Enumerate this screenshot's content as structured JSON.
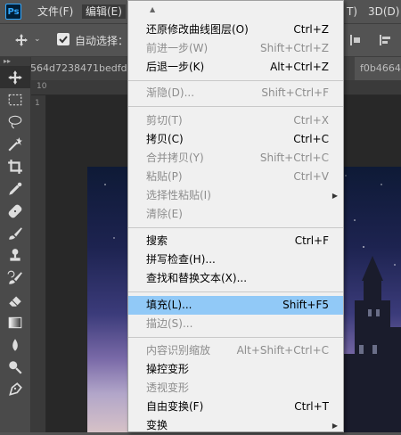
{
  "menubar": {
    "logo": "Ps",
    "file": "文件(F)",
    "edit": "编辑(E)",
    "right_fragment": "T)",
    "3d": "3D(D)"
  },
  "options": {
    "auto_select": "自动选择："
  },
  "tabs": {
    "left": "564d7238471bedfd",
    "right": "f0b4664"
  },
  "ruler": {
    "top_label": "10",
    "side_label": "1"
  },
  "edit_menu": {
    "items": [
      {
        "label": "还原修改曲线图层(O)",
        "shortcut": "Ctrl+Z",
        "enabled": true
      },
      {
        "label": "前进一步(W)",
        "shortcut": "Shift+Ctrl+Z",
        "enabled": false
      },
      {
        "label": "后退一步(K)",
        "shortcut": "Alt+Ctrl+Z",
        "enabled": true
      },
      {
        "label": "渐隐(D)...",
        "shortcut": "Shift+Ctrl+F",
        "enabled": false
      },
      {
        "label": "剪切(T)",
        "shortcut": "Ctrl+X",
        "enabled": false
      },
      {
        "label": "拷贝(C)",
        "shortcut": "Ctrl+C",
        "enabled": true
      },
      {
        "label": "合并拷贝(Y)",
        "shortcut": "Shift+Ctrl+C",
        "enabled": false
      },
      {
        "label": "粘贴(P)",
        "shortcut": "Ctrl+V",
        "enabled": false
      },
      {
        "label": "选择性粘贴(I)",
        "shortcut": "",
        "enabled": false,
        "submenu": true
      },
      {
        "label": "清除(E)",
        "shortcut": "",
        "enabled": false
      },
      {
        "label": "搜索",
        "shortcut": "Ctrl+F",
        "enabled": true
      },
      {
        "label": "拼写检查(H)...",
        "shortcut": "",
        "enabled": true
      },
      {
        "label": "查找和替换文本(X)...",
        "shortcut": "",
        "enabled": true
      },
      {
        "label": "填充(L)...",
        "shortcut": "Shift+F5",
        "enabled": true,
        "highlighted": true
      },
      {
        "label": "描边(S)...",
        "shortcut": "",
        "enabled": false
      },
      {
        "label": "内容识别缩放",
        "shortcut": "Alt+Shift+Ctrl+C",
        "enabled": false
      },
      {
        "label": "操控变形",
        "shortcut": "",
        "enabled": true
      },
      {
        "label": "透视变形",
        "shortcut": "",
        "enabled": false
      },
      {
        "label": "自由变换(F)",
        "shortcut": "Ctrl+T",
        "enabled": true
      },
      {
        "label": "变换",
        "shortcut": "",
        "enabled": true,
        "submenu": true
      }
    ]
  }
}
